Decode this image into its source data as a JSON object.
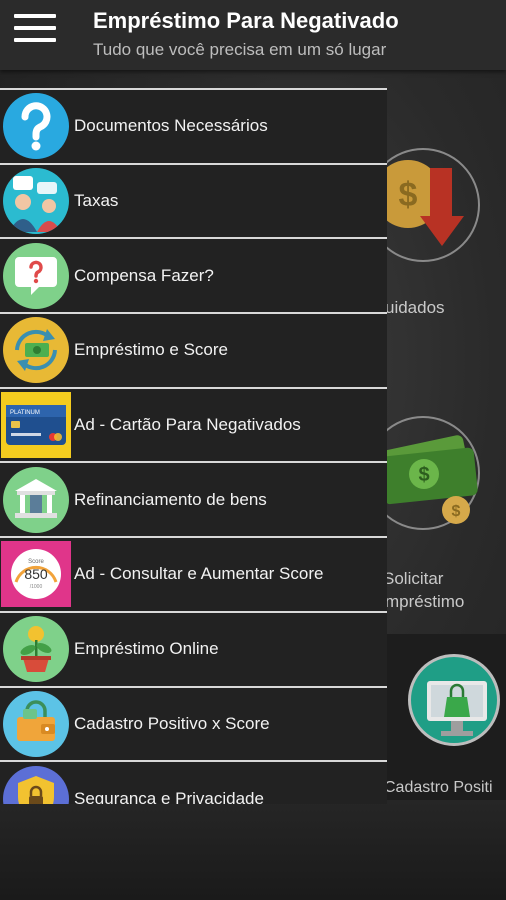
{
  "appbar": {
    "title": "Empréstimo Para Negativado",
    "subtitle": "Tudo que você precisa em um só lugar"
  },
  "background": {
    "label_1": "uidados",
    "label_2_line1": "Solicitar",
    "label_2_line2": "mpréstimo",
    "label_3": "Cadastro Positi"
  },
  "menu": {
    "items": [
      {
        "label": "Documentos Necessários",
        "icon": "question-mark-icon"
      },
      {
        "label": "Taxas",
        "icon": "people-chat-icon"
      },
      {
        "label": "Compensa Fazer?",
        "icon": "question-bubble-icon"
      },
      {
        "label": "Empréstimo e Score",
        "icon": "money-refresh-icon"
      },
      {
        "label": "Ad - Cartão Para Negativados",
        "icon": "credit-card-icon"
      },
      {
        "label": "Refinanciamento de bens",
        "icon": "bank-icon"
      },
      {
        "label": "Ad - Consultar e Aumentar Score",
        "icon": "score-gauge-icon"
      },
      {
        "label": "Empréstimo Online",
        "icon": "money-plant-icon"
      },
      {
        "label": "Cadastro Positivo x Score",
        "icon": "wallet-lock-icon"
      },
      {
        "label": "Seguranca e Privacidade",
        "icon": "shield-lock-icon"
      }
    ],
    "card_text": "PLATINUM",
    "score_value": "850",
    "score_top": "Score",
    "score_bottom": "/1000"
  }
}
